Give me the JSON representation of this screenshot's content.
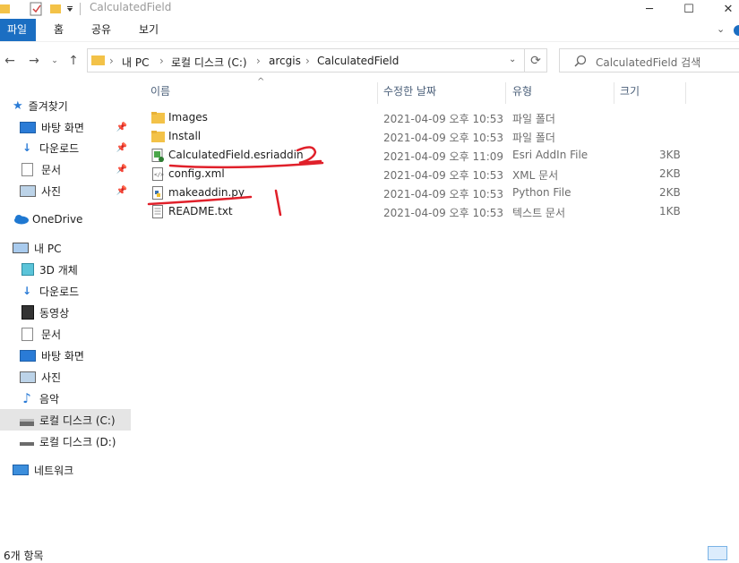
{
  "window": {
    "title": "CalculatedField",
    "controls": [
      "─",
      "☐",
      "✕"
    ]
  },
  "ribbon": {
    "tabs": [
      "파일",
      "홈",
      "공유",
      "보기"
    ]
  },
  "address": {
    "crumbs": [
      "내 PC",
      "로컬 디스크 (C:)",
      "arcgis",
      "CalculatedField"
    ]
  },
  "search": {
    "placeholder": "CalculatedField 검색"
  },
  "sidebar": {
    "quick_access": "즐겨찾기",
    "quick_items": [
      "바탕 화면",
      "다운로드",
      "문서",
      "사진"
    ],
    "onedrive": "OneDrive",
    "this_pc": "내 PC",
    "pc_items": [
      "3D 개체",
      "다운로드",
      "동영상",
      "문서",
      "바탕 화면",
      "사진",
      "음악",
      "로컬 디스크 (C:)",
      "로컬 디스크 (D:)"
    ],
    "network": "네트워크"
  },
  "columns": {
    "name": "이름",
    "date": "수정한 날짜",
    "type": "유형",
    "size": "크기"
  },
  "files": [
    {
      "name": "Images",
      "date": "2021-04-09 오후 10:53",
      "type": "파일 폴더",
      "size": "",
      "icon": "folder-icon"
    },
    {
      "name": "Install",
      "date": "2021-04-09 오후 10:53",
      "type": "파일 폴더",
      "size": "",
      "icon": "folder-icon"
    },
    {
      "name": "CalculatedField.esriaddin",
      "date": "2021-04-09 오후 11:09",
      "type": "Esri AddIn File",
      "size": "3KB",
      "icon": "esri-addin-icon"
    },
    {
      "name": "config.xml",
      "date": "2021-04-09 오후 10:53",
      "type": "XML 문서",
      "size": "2KB",
      "icon": "xml-file-icon"
    },
    {
      "name": "makeaddin.py",
      "date": "2021-04-09 오후 10:53",
      "type": "Python File",
      "size": "2KB",
      "icon": "python-file-icon"
    },
    {
      "name": "README.txt",
      "date": "2021-04-09 오후 10:53",
      "type": "텍스트 문서",
      "size": "1KB",
      "icon": "text-file-icon"
    }
  ],
  "status": {
    "count": "6개 항목"
  },
  "annotations": {
    "mark1": "1",
    "mark2": "2",
    "color": "#e0202a"
  },
  "colors": {
    "accent": "#1b6ec2",
    "folder": "#f3c248",
    "header_text": "#4c607a"
  }
}
